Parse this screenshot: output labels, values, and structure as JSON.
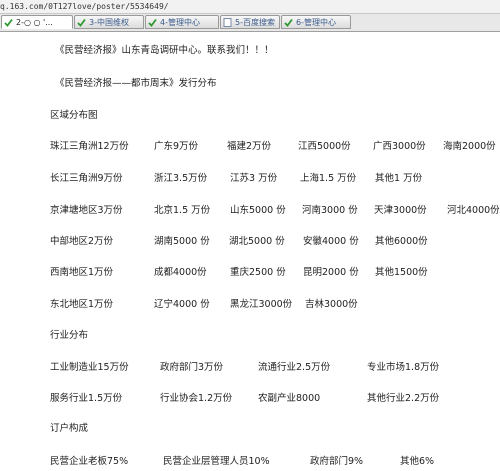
{
  "browser": {
    "url": "q.163.com/0T127love/poster/5534649/",
    "tabs": [
      {
        "label": "2-○ ○ '..."
      },
      {
        "label": "3-中国维权"
      },
      {
        "label": "4-管理中心"
      },
      {
        "label": "5-百度搜索"
      },
      {
        "label": "6-管理中心"
      }
    ]
  },
  "page": {
    "intro1": "《民营经济报》山东青岛调研中心。联系我们！！！",
    "intro2": "《民营经济报——都市周末》发行分布",
    "section_region": "区域分布图",
    "regions": [
      [
        "珠江三角洲12万份",
        "广东9万份",
        "福建2万份",
        "江西5000份",
        "广西3000份",
        "海南2000份"
      ],
      [
        "长江三角洲9万份",
        "浙江3.5万份",
        "江苏3 万份",
        "上海1.5 万份",
        "其他1 万份"
      ],
      [
        "京津塘地区3万份",
        "北京1.5 万份",
        "山东5000 份",
        "河南3000 份",
        "天津3000份",
        "河北4000份"
      ],
      [
        "中部地区2万份",
        "湖南5000 份",
        "湖北5000 份",
        "安徽4000 份",
        "其他6000份"
      ],
      [
        "西南地区1万份",
        "成都4000份",
        "重庆2500 份",
        "昆明2000 份",
        "其他1500份"
      ],
      [
        "东北地区1万份",
        "辽宁4000 份",
        "黑龙江3000份",
        "吉林3000份"
      ]
    ],
    "section_industry": "行业分布",
    "industries": [
      [
        "工业制造业15万份",
        "政府部门3万份",
        "流通行业2.5万份",
        "专业市场1.8万份"
      ],
      [
        "服务行业1.5万份",
        "行业协会1.2万份",
        "农副产业8000",
        "其他行业2.2万份"
      ]
    ],
    "section_subscribers": "订户构成",
    "subscribers": [
      [
        "民营企业老板75%",
        "民营企业层管理人员10%",
        "政府部门9%",
        "其他6%"
      ]
    ]
  }
}
